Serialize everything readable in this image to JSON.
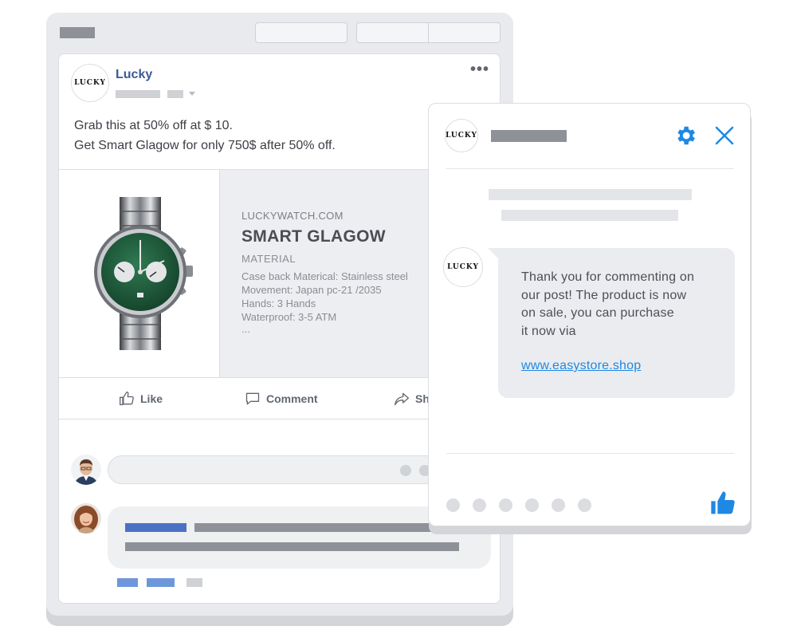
{
  "post": {
    "page_name": "Lucky",
    "logo_text": "LUCKY",
    "more_icon": "more-horizontal-icon",
    "text_lines": [
      "Grab this at 50% off at $ 10.",
      "Get Smart Glagow for only 750$ after 50% off."
    ],
    "product": {
      "domain": "LUCKYWATCH.COM",
      "title": "SMART GLAGOW",
      "subtitle": "MATERIAL",
      "specs": [
        "Case back Materical:  Stainless steel",
        "Movement:  Japan pc-21 /2035",
        "Hands:  3  Hands",
        "Waterproof:  3-5 ATM",
        "..."
      ]
    },
    "actions": {
      "like": "Like",
      "comment": "Comment",
      "share": "Share"
    }
  },
  "chat": {
    "logo_text": "LUCKY",
    "settings_icon": "gear-icon",
    "close_icon": "close-icon",
    "message": "Thank you for commenting on\nour post! The product is now\non sale, you can purchase\nit now via",
    "link": "www.easystore.shop",
    "like_icon": "thumbs-up-icon"
  },
  "colors": {
    "brand_blue": "#3b5998",
    "messenger_blue": "#1e88e5",
    "watch_dial": "#1f5a3a"
  }
}
